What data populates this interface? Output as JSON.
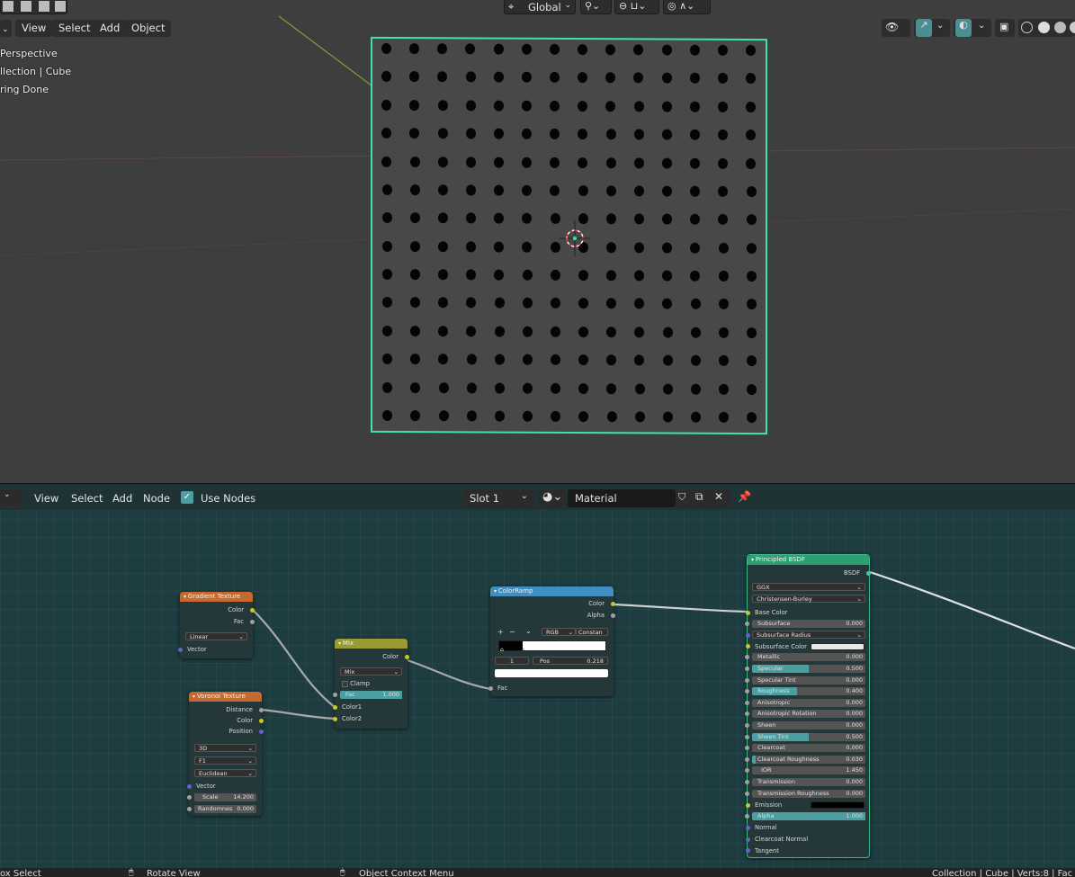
{
  "viewport": {
    "header": {
      "menus": [
        "View",
        "Select",
        "Add",
        "Object"
      ],
      "orientation": "Global"
    },
    "info": {
      "line1": "Perspective",
      "line2": "llection | Cube",
      "line3": "ring Done"
    },
    "grid": {
      "rows": 14,
      "cols": 14
    },
    "colors": {
      "selection": "#3fe3ad",
      "background": "#3e3e3e"
    }
  },
  "node_editor": {
    "header": {
      "menus": [
        "View",
        "Select",
        "Add",
        "Node"
      ],
      "use_nodes_label": "Use Nodes",
      "slot": "Slot 1",
      "material": "Material"
    },
    "nodes": {
      "gradient": {
        "title": "Gradient Texture",
        "out_color": "Color",
        "out_fac": "Fac",
        "type": "Linear",
        "in_vector": "Vector"
      },
      "voronoi": {
        "title": "Voronoi Texture",
        "out_distance": "Distance",
        "out_color": "Color",
        "out_position": "Position",
        "dims": "3D",
        "feature": "F1",
        "metric": "Euclidean",
        "in_vector": "Vector",
        "scale_label": "Scale",
        "scale_value": "14.200",
        "random_label": "Randomnes",
        "random_value": "0.000"
      },
      "mix": {
        "title": "Mix",
        "out_color": "Color",
        "blend": "Mix",
        "clamp": "Clamp",
        "fac_label": "Fac",
        "fac_value": "1.000",
        "color1": "Color1",
        "color2": "Color2"
      },
      "colorramp": {
        "title": "ColorRamp",
        "out_color": "Color",
        "out_alpha": "Alpha",
        "plus": "+",
        "minus": "−",
        "mode": "RGB",
        "interp": "Constan",
        "index": "1",
        "pos_label": "Pos",
        "pos_value": "0.218",
        "in_fac": "Fac"
      },
      "bsdf": {
        "title": "Principled BSDF",
        "out": "BSDF",
        "distribution": "GGX",
        "subsurface_method": "Christensen-Burley",
        "rows": [
          {
            "label": "Base Color",
            "value": "",
            "kind": "socket"
          },
          {
            "label": "Subsurface",
            "value": "0.000",
            "kind": "field",
            "fill": 0
          },
          {
            "label": "Subsurface Radius",
            "value": "",
            "kind": "dropdown"
          },
          {
            "label": "Subsurface Color",
            "value": "",
            "kind": "color",
            "swatch": "#e8e8e8"
          },
          {
            "label": "Metallic",
            "value": "0.000",
            "kind": "field",
            "fill": 0
          },
          {
            "label": "Specular",
            "value": "0.500",
            "kind": "field",
            "fill": 0.5
          },
          {
            "label": "Specular Tint",
            "value": "0.000",
            "kind": "field",
            "fill": 0
          },
          {
            "label": "Roughness",
            "value": "0.400",
            "kind": "field",
            "fill": 0.4
          },
          {
            "label": "Anisotropic",
            "value": "0.000",
            "kind": "field",
            "fill": 0
          },
          {
            "label": "Anisotropic Rotation",
            "value": "0.000",
            "kind": "field",
            "fill": 0
          },
          {
            "label": "Sheen",
            "value": "0.000",
            "kind": "field",
            "fill": 0
          },
          {
            "label": "Sheen Tint",
            "value": "0.500",
            "kind": "field",
            "fill": 0.5
          },
          {
            "label": "Clearcoat",
            "value": "0.000",
            "kind": "field",
            "fill": 0
          },
          {
            "label": "Clearcoat Roughness",
            "value": "0.030",
            "kind": "field",
            "fill": 0.03
          },
          {
            "label": "IOR",
            "value": "1.450",
            "kind": "number"
          },
          {
            "label": "Transmission",
            "value": "0.000",
            "kind": "field",
            "fill": 0
          },
          {
            "label": "Transmission Roughness",
            "value": "0.000",
            "kind": "field",
            "fill": 0
          },
          {
            "label": "Emission",
            "value": "",
            "kind": "color",
            "swatch": "#000000"
          },
          {
            "label": "Alpha",
            "value": "1.000",
            "kind": "field",
            "fill": 1
          },
          {
            "label": "Normal",
            "value": "",
            "kind": "socket"
          },
          {
            "label": "Clearcoat Normal",
            "value": "",
            "kind": "socket"
          },
          {
            "label": "Tangent",
            "value": "",
            "kind": "socket"
          }
        ]
      }
    }
  },
  "statusbar": {
    "left": "ox Select",
    "mid": "Rotate View",
    "mid2": "Object Context Menu",
    "right": "Collection | Cube | Verts:8 | Fac"
  }
}
